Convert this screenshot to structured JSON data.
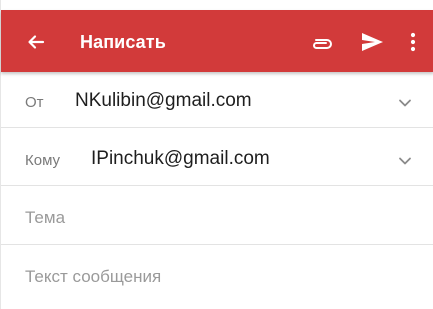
{
  "toolbar": {
    "title": "Написать",
    "background": "#d23a3a",
    "back_icon": "arrow-back-icon",
    "attach_icon": "paperclip-icon",
    "send_icon": "send-icon",
    "more_icon": "more-vert-icon"
  },
  "from": {
    "label": "От",
    "value": "NKulibin@gmail.com",
    "icon": "chevron-down-icon"
  },
  "to": {
    "label": "Кому",
    "value": "IPinchuk@gmail.com",
    "icon": "chevron-down-icon"
  },
  "subject": {
    "placeholder": "Тема"
  },
  "body": {
    "placeholder": "Текст сообщения"
  }
}
